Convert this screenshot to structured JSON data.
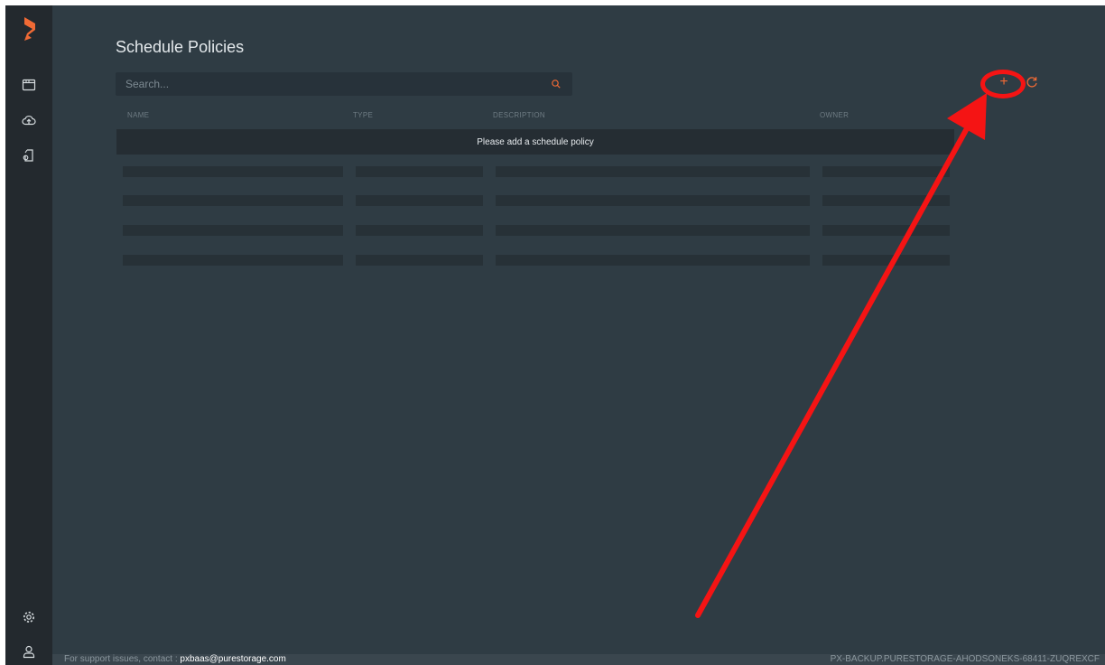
{
  "page": {
    "title": "Schedule Policies"
  },
  "search": {
    "placeholder": "Search..."
  },
  "table": {
    "columns": [
      "NAME",
      "TYPE",
      "DESCRIPTION",
      "OWNER"
    ],
    "empty_message": "Please add a schedule policy",
    "placeholder_row_count": 4
  },
  "toolbar": {
    "add_label": "+"
  },
  "sidebar": {
    "items": [
      {
        "icon": "logo-icon"
      },
      {
        "icon": "browser-window-icon"
      },
      {
        "icon": "cloud-upload-icon"
      },
      {
        "icon": "document-policy-icon"
      },
      {
        "icon": "gear-icon"
      },
      {
        "icon": "user-icon"
      }
    ]
  },
  "footer": {
    "support_text": "For support issues, contact : ",
    "support_email": "pxbaas@purestorage.com",
    "cluster_id": "PX-BACKUP.PURESTORAGE-AHODSONEKS-68411-ZUQREXCF"
  },
  "colors": {
    "accent": "#f06a35",
    "annotation": "#f51414",
    "background": "#2f3c44",
    "sidebar": "#23292e"
  }
}
